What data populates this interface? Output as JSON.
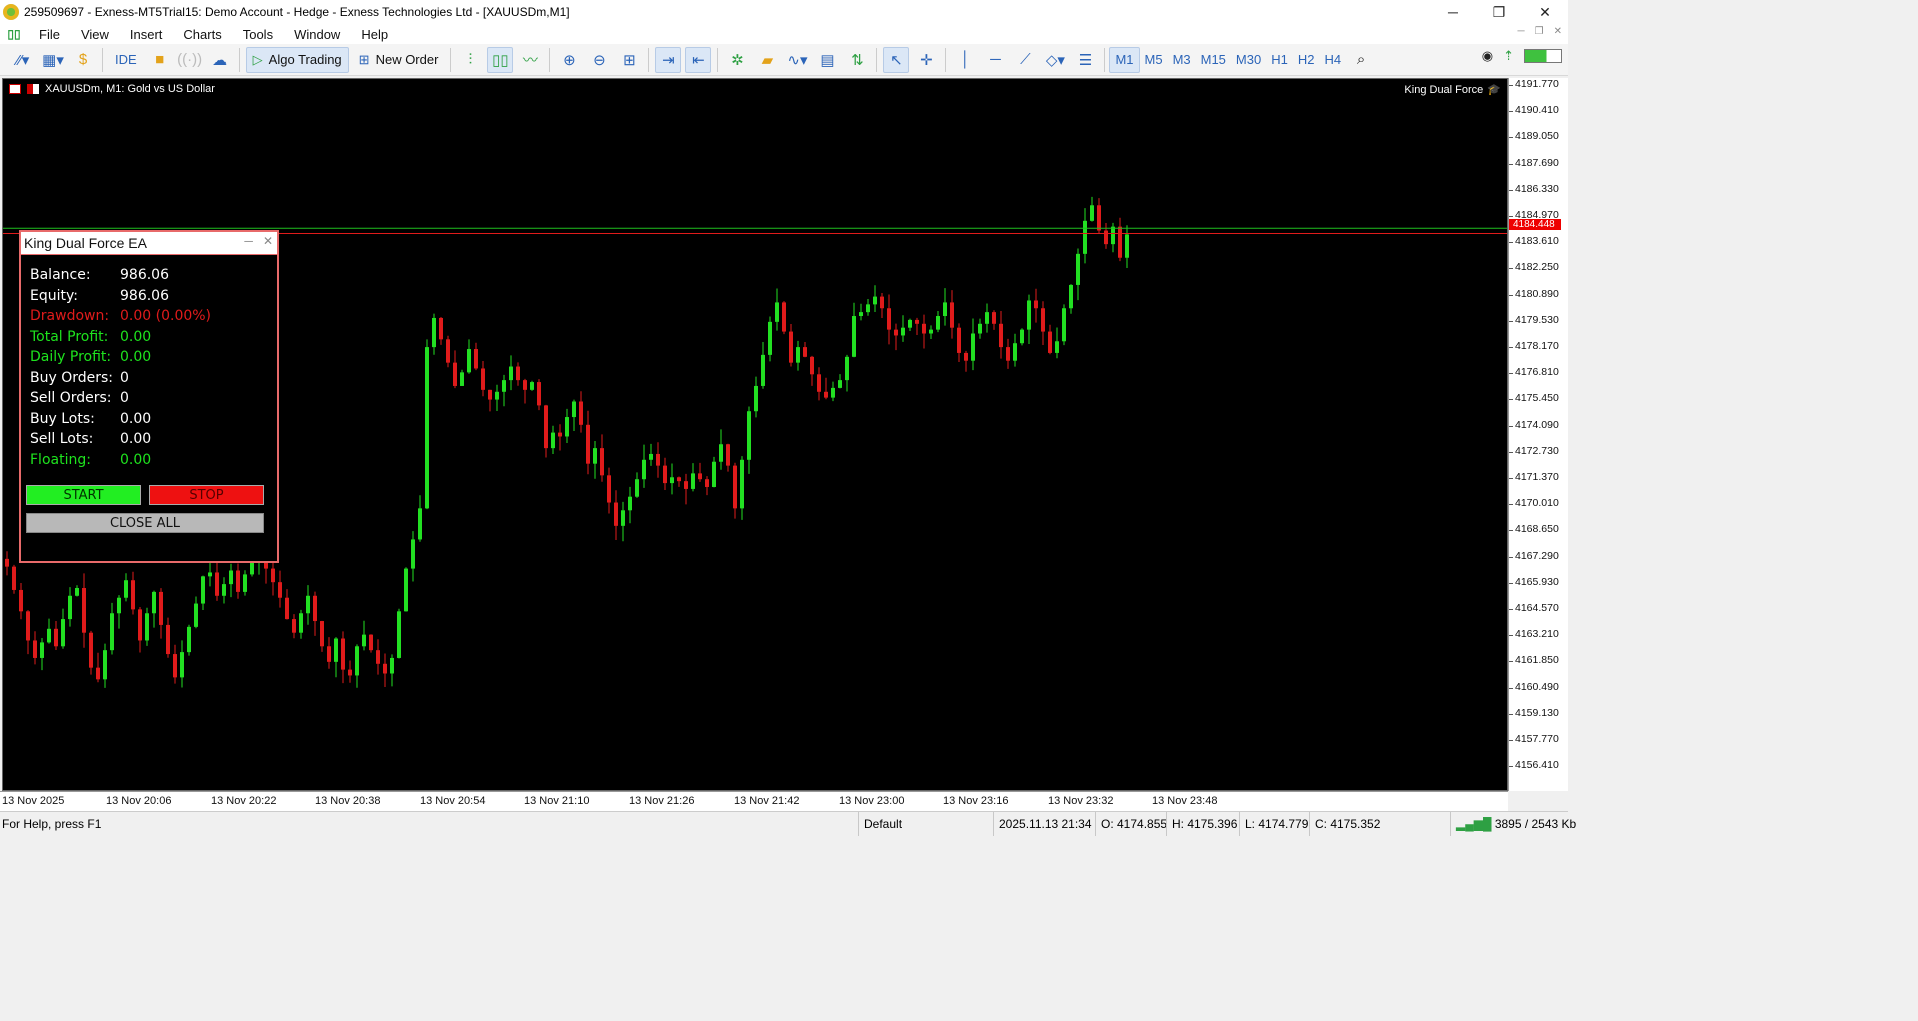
{
  "window": {
    "title": "259509697 - Exness-MT5Trial15: Demo Account - Hedge - Exness Technologies Ltd - [XAUUSDm,M1]",
    "min_label": "─",
    "max_label": "❐",
    "close_label": "✕"
  },
  "menu": [
    "File",
    "View",
    "Insert",
    "Charts",
    "Tools",
    "Window",
    "Help"
  ],
  "toolbar": {
    "ide_label": "IDE",
    "algo_trading_label": "Algo Trading",
    "new_order_label": "New Order",
    "timeframes": [
      "M1",
      "M5",
      "M3",
      "M15",
      "M30",
      "H1",
      "H2",
      "H4"
    ],
    "active_timeframe": "M1",
    "battery_level": 0.6
  },
  "chart": {
    "symbol_line": "XAUUSDm, M1:  Gold vs US Dollar",
    "ea_label": "King Dual Force",
    "current_price_label": "4184.448",
    "price_ticks": [
      "4191.770",
      "4190.410",
      "4189.050",
      "4187.690",
      "4186.330",
      "4184.970",
      "4183.610",
      "4182.250",
      "4180.890",
      "4179.530",
      "4178.170",
      "4176.810",
      "4175.450",
      "4174.090",
      "4172.730",
      "4171.370",
      "4170.010",
      "4168.650",
      "4167.290",
      "4165.930",
      "4164.570",
      "4163.210",
      "4161.850",
      "4160.490",
      "4159.130",
      "4157.770",
      "4156.410"
    ],
    "time_labels": [
      "13 Nov 2025",
      "13 Nov 20:06",
      "13 Nov 20:22",
      "13 Nov 20:38",
      "13 Nov 20:54",
      "13 Nov 21:10",
      "13 Nov 21:26",
      "13 Nov 21:42",
      "13 Nov 23:00",
      "13 Nov 23:16",
      "13 Nov 23:32",
      "13 Nov 23:48"
    ],
    "colors": {
      "bull": "#22e022",
      "bear": "#e01b1b",
      "background": "#000000",
      "ask_line": "#1fbf1f",
      "bid_line": "#e01b1b"
    }
  },
  "chart_data": {
    "type": "candlestick",
    "ylim": [
      4155.7,
      4192.4
    ],
    "bid": 4184.448,
    "ask": 4184.72,
    "closes": [
      4167.3,
      4166.1,
      4165.0,
      4163.5,
      4162.6,
      4163.4,
      4164.1,
      4163.2,
      4164.6,
      4165.8,
      4166.2,
      4163.9,
      4162.1,
      4161.5,
      4163.0,
      4164.9,
      4165.7,
      4166.6,
      4165.1,
      4163.5,
      4164.9,
      4166.0,
      4164.3,
      4162.8,
      4161.6,
      4162.9,
      4164.2,
      4165.4,
      4166.8,
      4167.0,
      4165.8,
      4166.4,
      4167.1,
      4166.0,
      4166.9,
      4167.5,
      4168.0,
      4167.2,
      4166.5,
      4165.7,
      4164.6,
      4163.9,
      4164.9,
      4165.8,
      4164.5,
      4163.2,
      4162.4,
      4163.6,
      4162.0,
      4161.7,
      4163.2,
      4163.8,
      4163.0,
      4162.3,
      4161.8,
      4162.6,
      4165.0,
      4167.2,
      4168.7,
      4170.3,
      4178.6,
      4180.1,
      4179.0,
      4177.8,
      4176.6,
      4177.3,
      4178.5,
      4177.5,
      4176.4,
      4175.9,
      4176.3,
      4176.9,
      4177.6,
      4176.9,
      4176.4,
      4176.8,
      4175.6,
      4173.4,
      4174.2,
      4174.0,
      4175.0,
      4175.8,
      4174.6,
      4172.6,
      4173.4,
      4172.0,
      4170.6,
      4169.4,
      4170.2,
      4170.9,
      4171.8,
      4172.8,
      4173.1,
      4172.5,
      4171.6,
      4171.9,
      4171.7,
      4171.3,
      4172.1,
      4171.8,
      4171.4,
      4172.7,
      4173.6,
      4172.5,
      4170.3,
      4172.8,
      4175.3,
      4176.6,
      4178.2,
      4179.9,
      4180.9,
      4179.4,
      4177.8,
      4178.6,
      4178.1,
      4177.2,
      4176.3,
      4176.0,
      4176.5,
      4176.9,
      4178.1,
      4180.2,
      4180.4,
      4180.8,
      4181.2,
      4180.6,
      4179.5,
      4179.2,
      4179.6,
      4180.0,
      4179.8,
      4179.3,
      4179.5,
      4180.2,
      4180.9,
      4179.6,
      4178.3,
      4177.9,
      4179.3,
      4179.8,
      4180.4,
      4179.8,
      4178.6,
      4177.9,
      4178.8,
      4179.5,
      4181.0,
      4180.6,
      4179.4,
      4178.3,
      4178.9,
      4180.6,
      4181.8,
      4183.4,
      4185.1,
      4185.9,
      4184.6,
      4183.9,
      4184.8,
      4183.2,
      4184.4
    ]
  },
  "ea_panel": {
    "title": "King Dual Force EA",
    "rows": [
      {
        "label": "Balance:",
        "value": "986.06"
      },
      {
        "label": "Equity:",
        "value": "986.06"
      },
      {
        "label": "Drawdown:",
        "value": "0.00 (0.00%)"
      },
      {
        "label": "Total Profit:",
        "value": "0.00"
      },
      {
        "label": "Daily Profit:",
        "value": "0.00"
      },
      {
        "label": "Buy Orders:",
        "value": "0"
      },
      {
        "label": "Sell Orders:",
        "value": "0"
      },
      {
        "label": "Buy Lots:",
        "value": "0.00"
      },
      {
        "label": "Sell Lots:",
        "value": "0.00"
      },
      {
        "label": "Floating:",
        "value": "0.00"
      }
    ],
    "start_label": "START",
    "stop_label": "STOP",
    "close_all_label": "CLOSE ALL",
    "minimize_label": "─",
    "close_label": "✕"
  },
  "status": {
    "help": "For Help, press F1",
    "profile": "Default",
    "datetime": "2025.11.13 21:34",
    "open": "O: 4174.855",
    "high": "H: 4175.396",
    "low": "L: 4174.779",
    "close": "C: 4175.352",
    "traffic": "3895 / 2543 Kb"
  }
}
